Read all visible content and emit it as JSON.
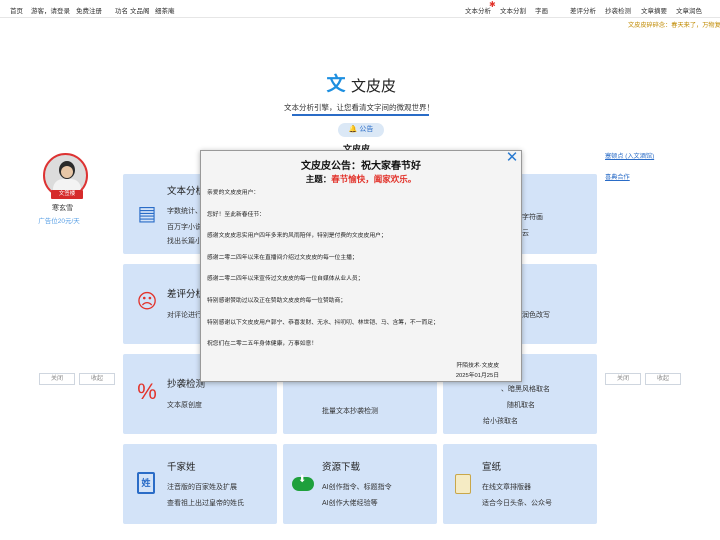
{
  "topnav": {
    "home": "首页",
    "guest": "游客，请登录",
    "register": "免费注册",
    "gongming": "功名",
    "wenpin": "文品阁",
    "xichaan": "细茶庵",
    "text_analysis": "文本分析",
    "text_split": "文本分割",
    "font": "字画",
    "bad_review": "差评分析",
    "plagiarism": "抄袭检测",
    "summary": "文章摘要",
    "polish": "文章润色"
  },
  "marquee": "文皮皮碎碎念：春天来了，万物复苏",
  "header": {
    "logo_char": "文",
    "site_name": "文皮皮",
    "slogan": "文本分析引擎，让您看清文字间的微观世界！",
    "notice_button": "公告",
    "behind_title": "文皮皮"
  },
  "left_ad": {
    "badge": "文签楼",
    "name": "寒玄雪",
    "price": "广告位20元/天",
    "close": "关闭",
    "collapse": "收起"
  },
  "right_ad": {
    "link1": "塞顿点 (入文酒馆)",
    "link2": "喜典合作",
    "close": "关闭",
    "collapse": "收起"
  },
  "cards": {
    "text_analysis": {
      "icon": "chart-doc-icon",
      "title": "文本分析",
      "lines": [
        "字数统计、",
        "百万字小说",
        "找出长篇小"
      ]
    },
    "topright1": {
      "lines": [
        "字符画",
        "云"
      ]
    },
    "bad_review": {
      "icon": "sad-face-icon",
      "title": "差评分析",
      "lines": [
        "对评论进行"
      ]
    },
    "topright2": {
      "lines": [
        "润色改写"
      ]
    },
    "plagiarism": {
      "icon": "percent-icon",
      "title": "抄袭检测",
      "lines": [
        "文本原创度"
      ]
    },
    "plag_mid": {
      "lines": [
        "批量文本抄袭检测"
      ]
    },
    "naming": {
      "lines": [
        "、暗黑风格取名",
        "随机取名",
        "给小孩取名"
      ]
    },
    "surnames": {
      "icon": "book-icon",
      "icon_char": "姓",
      "title": "千家姓",
      "lines": [
        "注音版的百家姓及扩展",
        "查看祖上出过皇帝的姓氏"
      ]
    },
    "downloads": {
      "icon": "cloud-download-icon",
      "title": "资源下载",
      "lines": [
        "AI创作指令、标题指令",
        "AI创作大佬经验等"
      ]
    },
    "xuanzhi": {
      "icon": "scroll-icon",
      "title": "宣纸",
      "lines": [
        "在线文章排版器",
        "适合今日头条、公众号"
      ]
    }
  },
  "modal": {
    "title": "文皮皮公告：祝大家春节好",
    "theme_label": "主题：",
    "theme_value": "春节愉快，阖家欢乐。",
    "greeting": "亲爱的文皮皮用户：",
    "p1": "您好！至此新春佳节：",
    "p2": "感谢文皮皮忠实用户四年多来的风雨陪伴，特别是付费的文皮皮用户；",
    "p3": "感谢二零二四年以来在直播间介绍过文皮皮的每一位主播；",
    "p4": "感谢二零二四年以来宣传过文皮皮的每一位自媒体从业人员；",
    "p5": "特别感谢赞助过以及正在赞助文皮皮的每一位赞助商；",
    "p6": "特别感谢以下文皮皮用户郭宁、恭喜发财、无水、抖叨叨、林世铠、马、含筹，不一而足；",
    "p7": "祝您们在二零二五年身体健康，万事如意！",
    "sign_org": "阡陌技术·文皮皮",
    "sign_date": "2025年01月25日"
  },
  "colors": {
    "accent_blue": "#2a6cc7",
    "card_bg": "#d3e3f8",
    "highlight_red": "#e2332b"
  }
}
